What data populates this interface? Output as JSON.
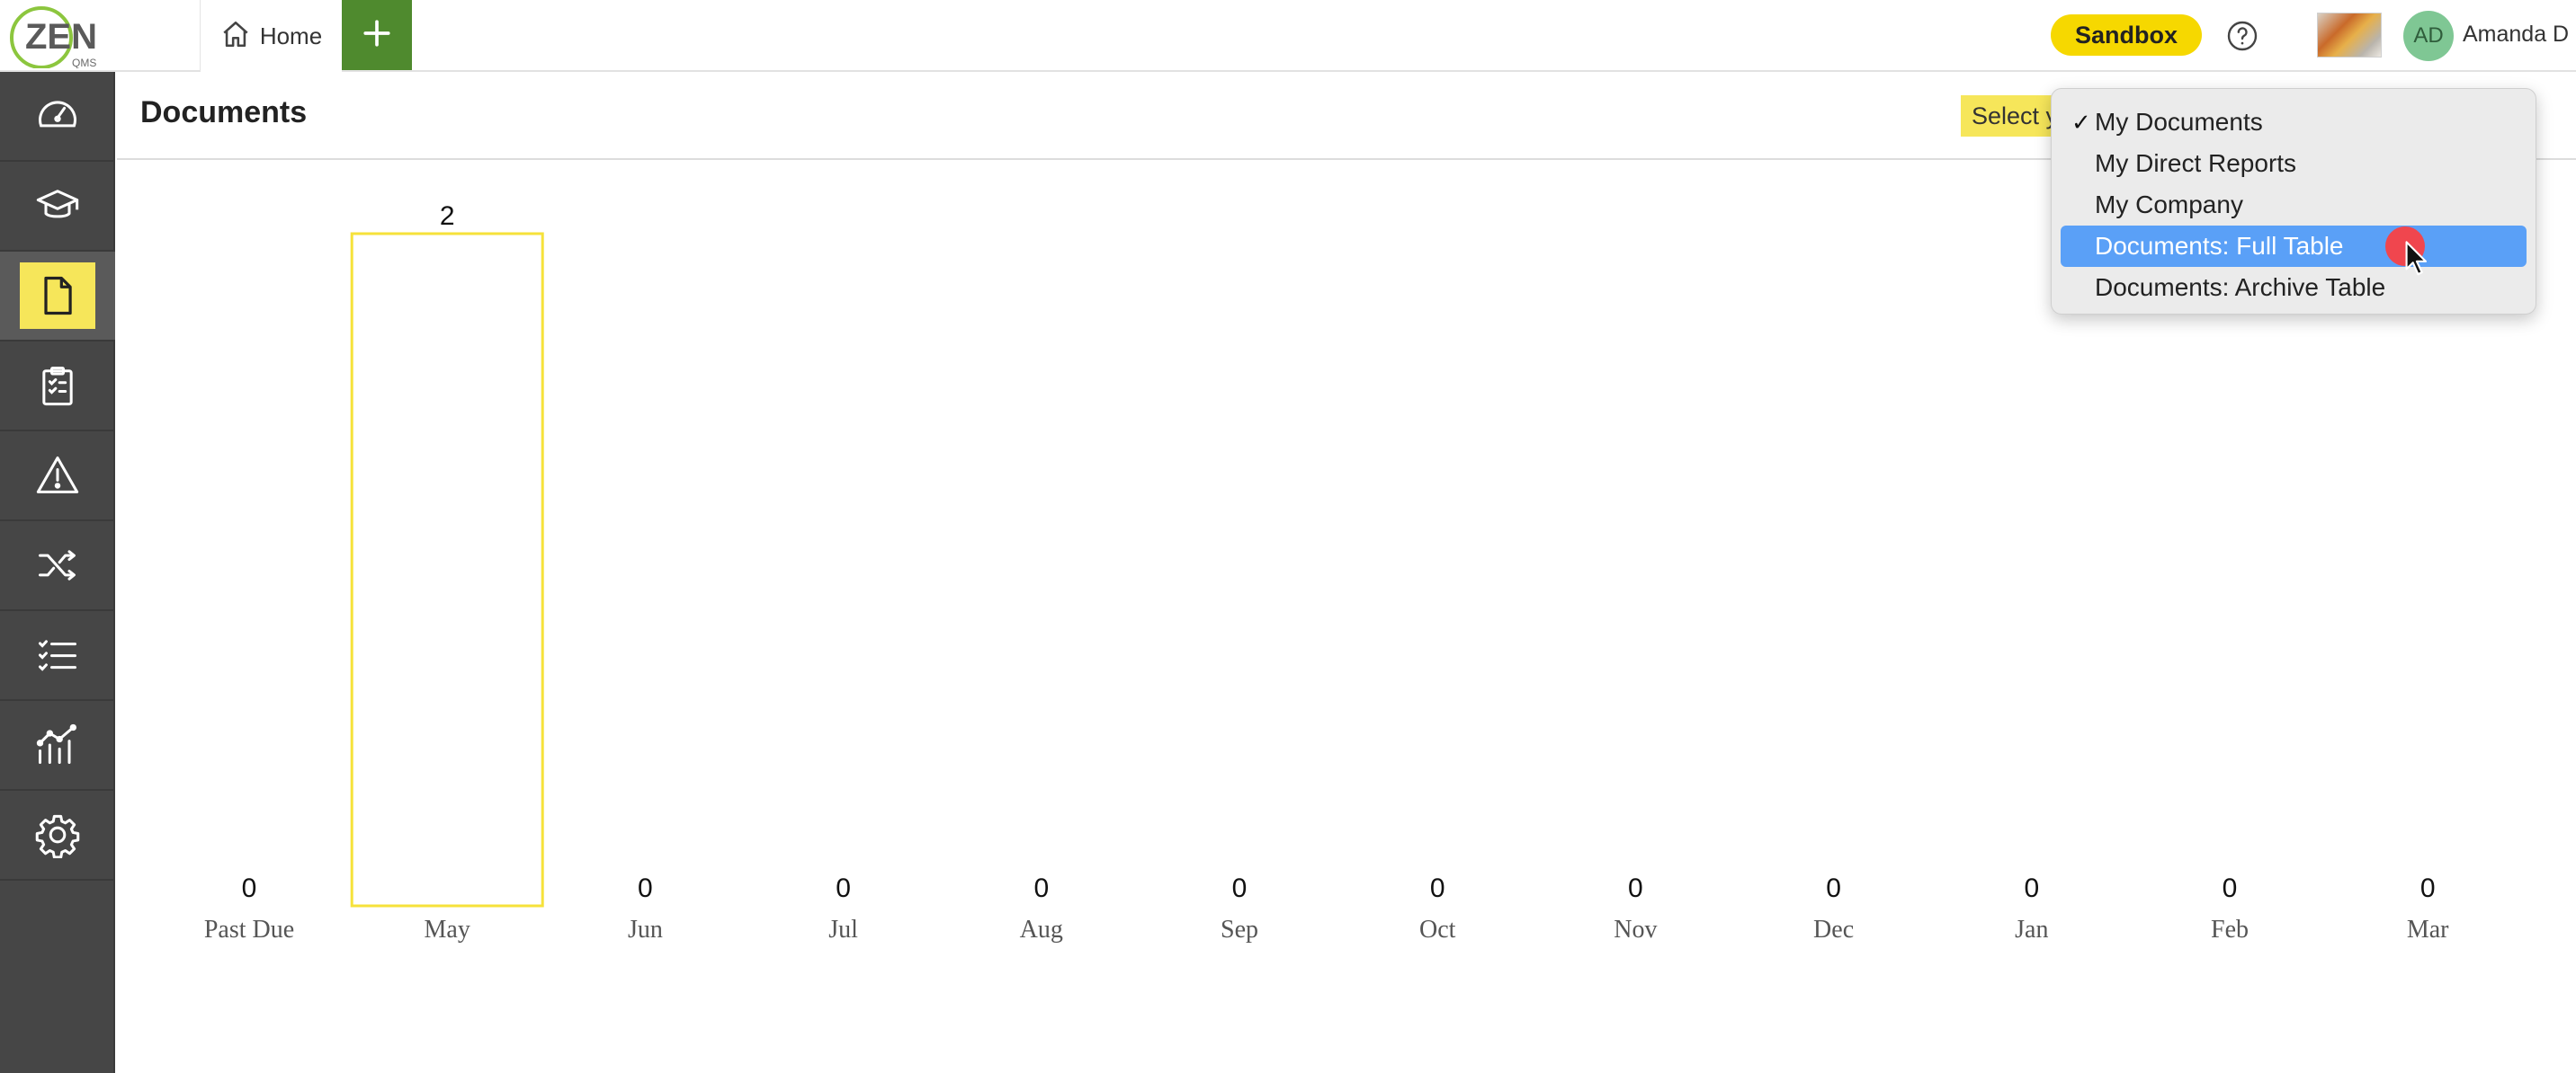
{
  "topbar": {
    "logo_text": "ZEN",
    "logo_sub": "QMS",
    "home_tab": "Home",
    "add_icon": "plus-icon",
    "sandbox_label": "Sandbox",
    "help_icon": "help-icon",
    "avatar_initials": "AD",
    "user_name": "Amanda D"
  },
  "sidebar": {
    "items": [
      {
        "icon": "dashboard-gauge-icon"
      },
      {
        "icon": "training-cap-icon"
      },
      {
        "icon": "document-icon",
        "active": true
      },
      {
        "icon": "clipboard-checklist-icon"
      },
      {
        "icon": "warning-triangle-icon"
      },
      {
        "icon": "shuffle-process-icon"
      },
      {
        "icon": "checklist-icon"
      },
      {
        "icon": "analytics-chart-icon"
      },
      {
        "icon": "settings-gear-icon"
      }
    ],
    "colors": {
      "background": "#464646",
      "active_highlight": "#f6e65a"
    }
  },
  "header": {
    "title": "Documents",
    "view_label": "Select your view:"
  },
  "view_dropdown": {
    "options": [
      {
        "label": "My Documents",
        "checked": true
      },
      {
        "label": "My Direct Reports"
      },
      {
        "label": "My Company"
      },
      {
        "label": "Documents: Full Table",
        "highlighted": true
      },
      {
        "label": "Documents: Archive Table"
      }
    ],
    "checkmark": "✓",
    "highlight_color": "#5aa0f7"
  },
  "chart_data": {
    "type": "bar",
    "categories": [
      "Past Due",
      "May",
      "Jun",
      "Jul",
      "Aug",
      "Sep",
      "Oct",
      "Nov",
      "Dec",
      "Jan",
      "Feb",
      "Mar"
    ],
    "values": [
      0,
      2,
      0,
      0,
      0,
      0,
      0,
      0,
      0,
      0,
      0,
      0
    ],
    "ylim": [
      0,
      2
    ],
    "bar_style": "outline",
    "bar_color": "#f6e23a",
    "grid": false,
    "legend": "none"
  }
}
